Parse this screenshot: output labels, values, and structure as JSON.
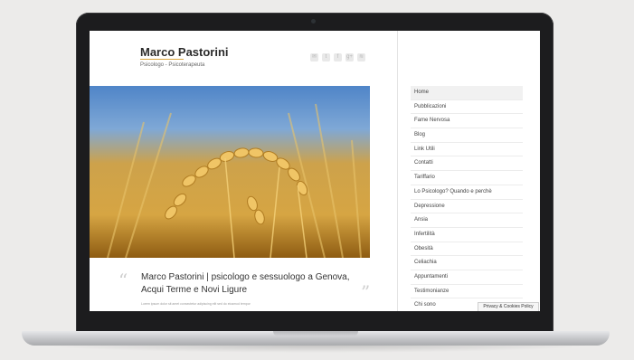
{
  "site": {
    "title": "Marco Pastorini",
    "subtitle": "Psicologo - Psicoterapeuta",
    "accent_color": "#d9a640"
  },
  "social_icons": [
    {
      "name": "email-icon",
      "glyph": "✉"
    },
    {
      "name": "twitter-icon",
      "glyph": "t"
    },
    {
      "name": "facebook-icon",
      "glyph": "f"
    },
    {
      "name": "google-plus-icon",
      "glyph": "g+"
    },
    {
      "name": "rss-icon",
      "glyph": "≋"
    }
  ],
  "hero": {
    "image_subject": "wheat-field-image"
  },
  "post": {
    "headline": "Marco Pastorini | psicologo e sessuologo a Genova, Acqui Terme e Novi Ligure",
    "excerpt": "Lorem ipsum dolor sit amet consectetur adipiscing elit sed do eiusmod tempor"
  },
  "nav": {
    "items": [
      {
        "label": "Home",
        "active": true
      },
      {
        "label": "Pubblicazioni"
      },
      {
        "label": "Fame Nervosa"
      },
      {
        "label": "Blog"
      },
      {
        "label": "Link Utili"
      },
      {
        "label": "Contatti"
      },
      {
        "label": "Tariffario"
      },
      {
        "label": "Lo Psicologo? Quando e perchè"
      },
      {
        "label": "Depressione"
      },
      {
        "label": "Ansia"
      },
      {
        "label": "Infertilità"
      },
      {
        "label": "Obesità"
      },
      {
        "label": "Celiachia"
      },
      {
        "label": "Appuntamenti"
      },
      {
        "label": "Testimonianze"
      },
      {
        "label": "Chi sono"
      }
    ]
  },
  "privacy_button": {
    "label": "Privacy & Cookies Policy"
  }
}
